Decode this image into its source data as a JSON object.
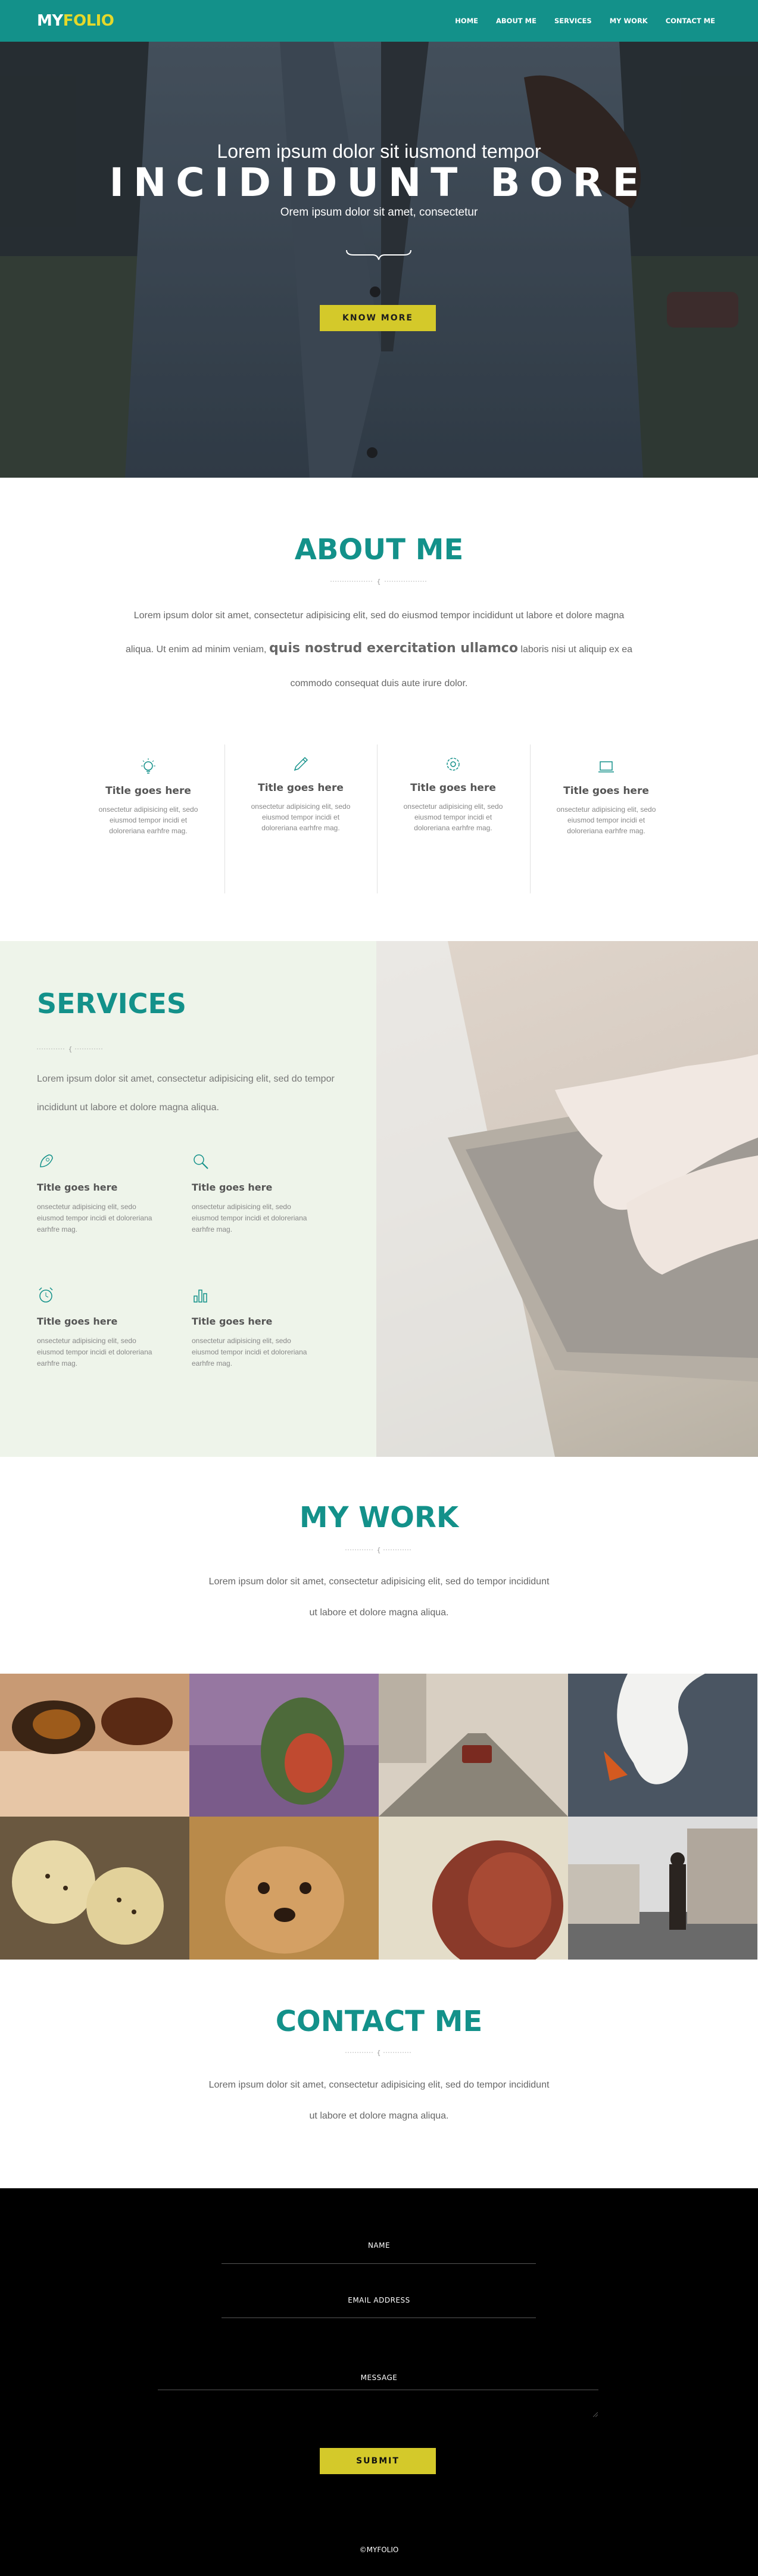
{
  "nav": {
    "logo_a": "MY",
    "logo_b": "FOLIO",
    "items": [
      "HOME",
      "ABOUT ME",
      "SERVICES",
      "MY WORK",
      "CONTACT ME"
    ]
  },
  "hero": {
    "subtitle": "Lorem ipsum dolor sit iusmond tempor",
    "title": "INCIDIDUNT BORE",
    "tagline": "Orem ipsum dolor sit amet, consectetur",
    "button": "KNOW MORE"
  },
  "about": {
    "title": "ABOUT ME",
    "text_1": "Lorem ipsum dolor sit amet, consectetur adipisicing elit, sed do eiusmod tempor incididunt ut labore et dolore magna",
    "text_2a": "aliqua. Ut enim ad minim veniam,",
    "text_2b": "quis nostrud exercitation ullamco",
    "text_2c": "laboris nisi ut aliquip ex ea",
    "text_3": "commodo consequat duis aute irure dolor.",
    "features": [
      {
        "icon": "lightbulb-icon",
        "title": "Title goes here",
        "text": "onsectetur adipisicing elit, sedo eiusmod tempor incidi et doloreriana earhfre mag."
      },
      {
        "icon": "pencil-icon",
        "title": "Title goes here",
        "text": "onsectetur adipisicing elit, sedo eiusmod tempor incidi et doloreriana earhfre mag."
      },
      {
        "icon": "gear-icon",
        "title": "Title goes here",
        "text": "onsectetur adipisicing elit, sedo eiusmod tempor incidi et doloreriana earhfre mag."
      },
      {
        "icon": "laptop-icon",
        "title": "Title goes here",
        "text": "onsectetur adipisicing elit, sedo eiusmod tempor incidi et doloreriana earhfre mag."
      }
    ]
  },
  "services": {
    "title": "SERVICES",
    "text": "Lorem ipsum dolor sit amet, consectetur adipisicing elit, sed do tempor incididunt ut labore et dolore magna aliqua.",
    "items": [
      {
        "icon": "rocket-icon",
        "title": "Title goes here",
        "text": "onsectetur adipisicing elit, sedo eiusmod tempor incidi et doloreriana earhfre mag."
      },
      {
        "icon": "magnifier-icon",
        "title": "Title goes here",
        "text": "onsectetur adipisicing elit, sedo eiusmod tempor incidi et doloreriana earhfre mag."
      },
      {
        "icon": "alarm-clock-icon",
        "title": "Title goes here",
        "text": "onsectetur adipisicing elit, sedo eiusmod tempor incidi et doloreriana earhfre mag."
      },
      {
        "icon": "bar-chart-icon",
        "title": "Title goes here",
        "text": "onsectetur adipisicing elit, sedo eiusmod tempor incidi et doloreriana earhfre mag."
      }
    ]
  },
  "work": {
    "title": "MY WORK",
    "text_1": "Lorem ipsum dolor sit amet, consectetur adipisicing elit, sed do tempor incididunt",
    "text_2": "ut labore et dolore magna aliqua."
  },
  "contact": {
    "title": "CONTACT ME",
    "text_1": "Lorem ipsum dolor sit amet, consectetur adipisicing elit, sed do tempor incididunt",
    "text_2": "ut labore et dolore magna aliqua.",
    "name_label": "NAME",
    "email_label": "EMAIL ADDRESS",
    "message_label": "MESSAGE",
    "submit": "SUBMIT"
  },
  "footer": {
    "copyright": "©MYFOLIO"
  },
  "colors": {
    "teal": "#13918a",
    "yellow": "#d4c92a",
    "services_bg": "#eef4ea",
    "footer_bg": "#000000"
  }
}
